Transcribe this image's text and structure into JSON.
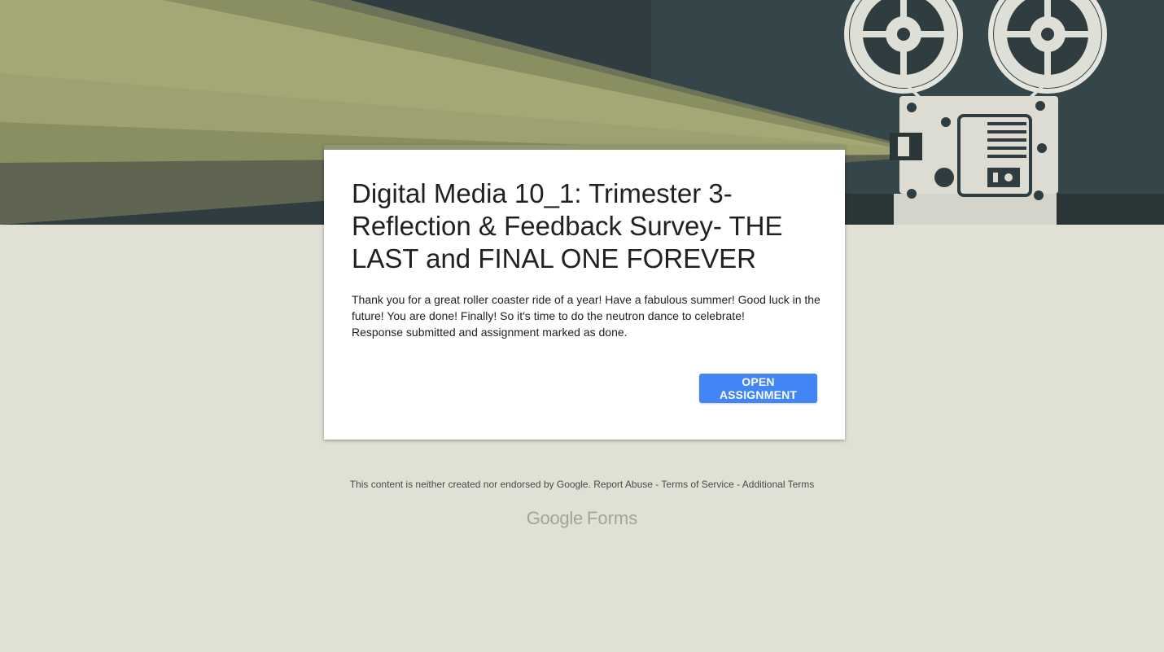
{
  "form": {
    "title": "Digital Media 10_1: Trimester 3- Reflection & Feedback Survey- THE LAST and FINAL ONE FOREVER",
    "description_line1": "Thank you for a great roller coaster ride of a year! Have a fabulous summer! Good luck in the future! You are done! Finally! So it's time to do the neutron dance to celebrate!",
    "description_line2": "Response submitted and assignment marked as done.",
    "open_button_label": "OPEN ASSIGNMENT"
  },
  "footer": {
    "disclaimer": "This content is neither created nor endorsed by Google.",
    "report_abuse": "Report Abuse",
    "terms": "Terms of Service",
    "additional_terms": "Additional Terms",
    "separator": " - "
  },
  "brand": {
    "google": "Google",
    "forms": "Forms"
  },
  "theme": {
    "page_bg": "#e0e0d4",
    "banner_olive": "#9a9f6f",
    "banner_dark": "#2f3d40",
    "accent": "#8f9670",
    "button": "#4285f4"
  },
  "header_image": "film-projector-icon"
}
